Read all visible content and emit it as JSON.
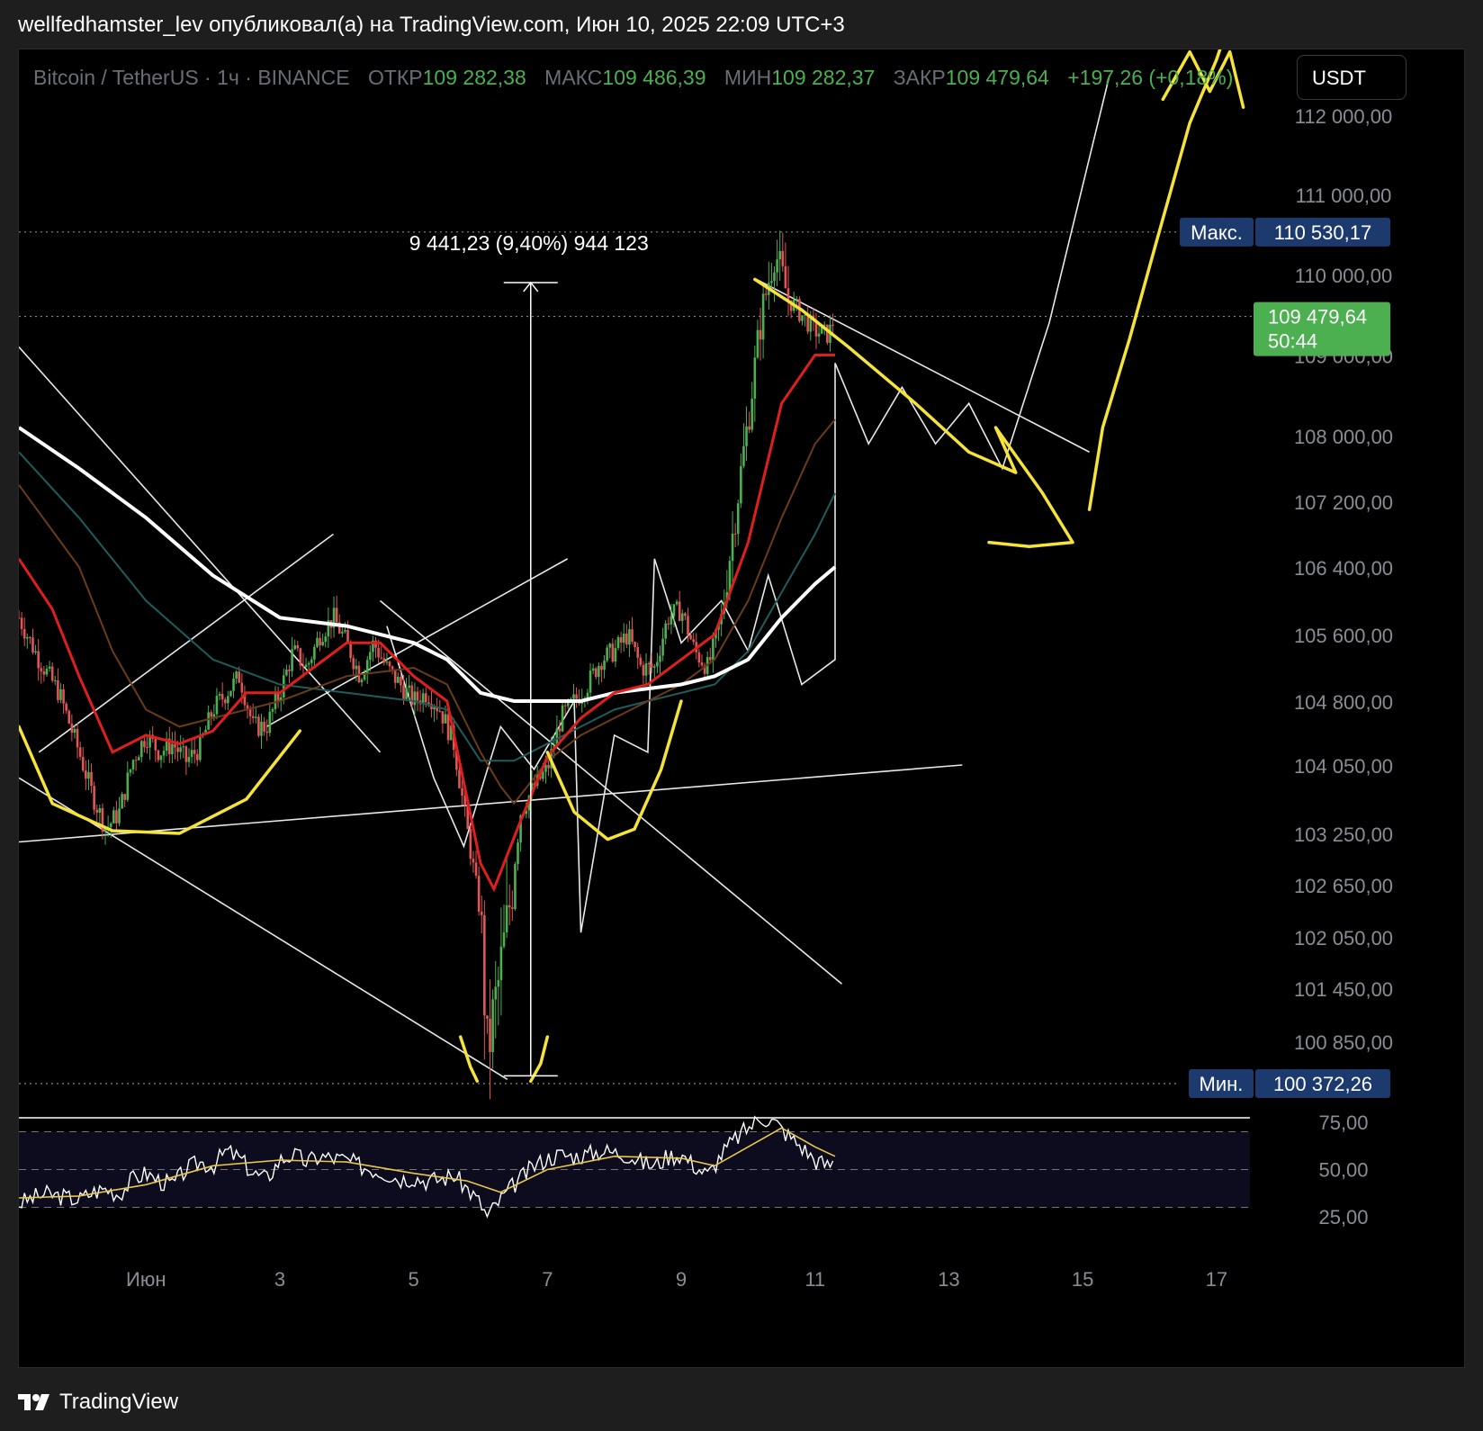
{
  "header": {
    "publish_line": "wellfedhamster_lev опубликовал(а) на TradingView.com, Июн 10, 2025 22:09 UTC+3"
  },
  "legend": {
    "symbol": "Bitcoin / TetherUS · 1ч · BINANCE",
    "open_label": "ОТКР",
    "open_value": "109 282,38",
    "high_label": "МАКС",
    "high_value": "109 486,39",
    "low_label": "МИН",
    "low_value": "109 282,37",
    "close_label": "ЗАКР",
    "close_value": "109 479,64",
    "change": "+197,26 (+0,18%)"
  },
  "currency_button": "USDT",
  "footer": {
    "brand": "TradingView"
  },
  "colors": {
    "background": "#000000",
    "bull": "#4caf50",
    "bear": "#e05555",
    "drawing_yellow": "#f5e33a",
    "drawing_white": "#ffffff",
    "ema_red": "#e01e1e",
    "price_badge": "#4caf50",
    "range_badge": "#1c3a6e"
  },
  "chart_data": {
    "type": "candlestick",
    "symbol": "Bitcoin / TetherUS",
    "timeframe": "1ч",
    "exchange": "BINANCE",
    "y_ticks": [
      "112 000,00",
      "111 000,00",
      "110 000,00",
      "108 000,00",
      "107 200,00",
      "106 400,00",
      "105 600,00",
      "104 800,00",
      "104 050,00",
      "103 250,00",
      "102 650,00",
      "102 050,00",
      "101 450,00",
      "100 850,00"
    ],
    "y_tick_values": [
      112000,
      111000,
      110000,
      108000,
      107200,
      106400,
      105600,
      104800,
      104050,
      103250,
      102650,
      102050,
      101450,
      100850
    ],
    "x_ticks": [
      "Июн",
      "3",
      "5",
      "7",
      "9",
      "11",
      "13",
      "15",
      "17"
    ],
    "x_tick_days": [
      1,
      3,
      5,
      7,
      9,
      11,
      13,
      15,
      17
    ],
    "x_range": [
      -0.9,
      17.5
    ],
    "high_label": "Макс.",
    "high_value": "110 530,17",
    "high_num": 110530.17,
    "low_label": "Мин.",
    "low_value": "100 372,26",
    "low_num": 100372.26,
    "last_price": "109 479,64",
    "last_num": 109479.64,
    "countdown": "50:44",
    "hidden_tick": "109 000,00",
    "measure_label": "9 441,23 (9,40%) 944 123",
    "measure_top": 109900,
    "measure_bottom": 100460,
    "measure_day": 6.75,
    "close_series": [
      [
        -0.9,
        105800
      ],
      [
        -0.6,
        105300
      ],
      [
        -0.3,
        104900
      ],
      [
        0,
        104200
      ],
      [
        0.2,
        103700
      ],
      [
        0.4,
        103300
      ],
      [
        0.6,
        103500
      ],
      [
        0.8,
        104100
      ],
      [
        1.0,
        104400
      ],
      [
        1.2,
        104200
      ],
      [
        1.4,
        104300
      ],
      [
        1.6,
        104100
      ],
      [
        1.8,
        104250
      ],
      [
        2.0,
        104700
      ],
      [
        2.2,
        104900
      ],
      [
        2.4,
        105100
      ],
      [
        2.6,
        104500
      ],
      [
        2.8,
        104500
      ],
      [
        3.0,
        104900
      ],
      [
        3.2,
        105400
      ],
      [
        3.4,
        105200
      ],
      [
        3.6,
        105600
      ],
      [
        3.8,
        105800
      ],
      [
        4.0,
        105500
      ],
      [
        4.2,
        105100
      ],
      [
        4.4,
        105500
      ],
      [
        4.6,
        105200
      ],
      [
        4.8,
        105000
      ],
      [
        5.0,
        104800
      ],
      [
        5.2,
        104900
      ],
      [
        5.4,
        104700
      ],
      [
        5.6,
        104300
      ],
      [
        5.8,
        103300
      ],
      [
        6.0,
        102300
      ],
      [
        6.1,
        100700
      ],
      [
        6.25,
        101400
      ],
      [
        6.4,
        102200
      ],
      [
        6.6,
        103500
      ],
      [
        6.8,
        103800
      ],
      [
        7.0,
        104000
      ],
      [
        7.2,
        104600
      ],
      [
        7.4,
        104800
      ],
      [
        7.6,
        105000
      ],
      [
        7.8,
        105300
      ],
      [
        8.0,
        105400
      ],
      [
        8.2,
        105600
      ],
      [
        8.4,
        105200
      ],
      [
        8.6,
        105200
      ],
      [
        8.8,
        105800
      ],
      [
        9.0,
        105900
      ],
      [
        9.2,
        105400
      ],
      [
        9.4,
        105200
      ],
      [
        9.6,
        105800
      ],
      [
        9.8,
        107000
      ],
      [
        10.0,
        108200
      ],
      [
        10.2,
        109500
      ],
      [
        10.4,
        110300
      ],
      [
        10.6,
        109700
      ],
      [
        10.8,
        109500
      ],
      [
        11.0,
        109300
      ],
      [
        11.2,
        109250
      ],
      [
        11.3,
        109480
      ]
    ],
    "ema_red": [
      [
        -0.9,
        106500
      ],
      [
        -0.4,
        105900
      ],
      [
        0,
        105100
      ],
      [
        0.5,
        104200
      ],
      [
        1.0,
        104400
      ],
      [
        1.5,
        104300
      ],
      [
        2.0,
        104450
      ],
      [
        2.5,
        104900
      ],
      [
        3.0,
        104900
      ],
      [
        3.5,
        105200
      ],
      [
        4.0,
        105500
      ],
      [
        4.5,
        105500
      ],
      [
        5.0,
        105100
      ],
      [
        5.5,
        104800
      ],
      [
        6.0,
        102900
      ],
      [
        6.2,
        102600
      ],
      [
        6.6,
        103400
      ],
      [
        7.0,
        104150
      ],
      [
        7.5,
        104600
      ],
      [
        8.0,
        104900
      ],
      [
        8.5,
        105000
      ],
      [
        9.0,
        105300
      ],
      [
        9.5,
        105600
      ],
      [
        10.0,
        106700
      ],
      [
        10.5,
        108400
      ],
      [
        11.0,
        109000
      ],
      [
        11.3,
        109000
      ]
    ],
    "ema_slow": [
      [
        -0.9,
        108100
      ],
      [
        0,
        107600
      ],
      [
        1,
        107000
      ],
      [
        2,
        106300
      ],
      [
        3,
        105800
      ],
      [
        4,
        105700
      ],
      [
        5,
        105500
      ],
      [
        5.5,
        105300
      ],
      [
        6,
        104900
      ],
      [
        6.5,
        104800
      ],
      [
        7,
        104800
      ],
      [
        7.5,
        104800
      ],
      [
        8,
        104900
      ],
      [
        8.5,
        104950
      ],
      [
        9,
        105000
      ],
      [
        9.5,
        105100
      ],
      [
        10,
        105300
      ],
      [
        10.5,
        105800
      ],
      [
        11,
        106200
      ],
      [
        11.3,
        106400
      ]
    ],
    "ema_teal": [
      [
        -0.9,
        107800
      ],
      [
        0,
        107000
      ],
      [
        1,
        106000
      ],
      [
        2,
        105300
      ],
      [
        3,
        105000
      ],
      [
        4,
        104900
      ],
      [
        5,
        104800
      ],
      [
        5.5,
        104700
      ],
      [
        6,
        104100
      ],
      [
        6.5,
        104100
      ],
      [
        7,
        104300
      ],
      [
        7.5,
        104500
      ],
      [
        8,
        104700
      ],
      [
        8.5,
        104800
      ],
      [
        9,
        104900
      ],
      [
        9.5,
        105000
      ],
      [
        10,
        105400
      ],
      [
        10.5,
        106100
      ],
      [
        11,
        106800
      ],
      [
        11.3,
        107300
      ]
    ],
    "ema_brown": [
      [
        -0.9,
        107400
      ],
      [
        0,
        106400
      ],
      [
        0.5,
        105400
      ],
      [
        1,
        104700
      ],
      [
        1.5,
        104500
      ],
      [
        2,
        104600
      ],
      [
        3,
        104800
      ],
      [
        4,
        105100
      ],
      [
        5,
        105200
      ],
      [
        5.5,
        105000
      ],
      [
        6,
        104200
      ],
      [
        6.3,
        103800
      ],
      [
        6.5,
        103600
      ],
      [
        7,
        104100
      ],
      [
        7.5,
        104400
      ],
      [
        8,
        104600
      ],
      [
        8.5,
        104800
      ],
      [
        9,
        105000
      ],
      [
        9.5,
        105300
      ],
      [
        10,
        106000
      ],
      [
        10.5,
        107000
      ],
      [
        11,
        107900
      ],
      [
        11.3,
        108200
      ]
    ],
    "rsi": {
      "levels": [
        25,
        50,
        75
      ],
      "tick_labels": [
        "75,00",
        "50,00",
        "25,00"
      ],
      "series": [
        [
          -0.9,
          32
        ],
        [
          -0.7,
          35
        ],
        [
          -0.5,
          37
        ],
        [
          -0.3,
          36
        ],
        [
          0,
          34
        ],
        [
          0.2,
          38
        ],
        [
          0.4,
          40
        ],
        [
          0.6,
          37
        ],
        [
          0.8,
          45
        ],
        [
          1.0,
          48
        ],
        [
          1.2,
          44
        ],
        [
          1.4,
          42
        ],
        [
          1.6,
          50
        ],
        [
          1.8,
          54
        ],
        [
          2.0,
          52
        ],
        [
          2.2,
          60
        ],
        [
          2.4,
          56
        ],
        [
          2.6,
          48
        ],
        [
          2.8,
          45
        ],
        [
          3.0,
          55
        ],
        [
          3.2,
          58
        ],
        [
          3.4,
          54
        ],
        [
          3.6,
          57
        ],
        [
          3.8,
          56
        ],
        [
          4.0,
          55
        ],
        [
          4.2,
          52
        ],
        [
          4.4,
          50
        ],
        [
          4.6,
          48
        ],
        [
          4.8,
          45
        ],
        [
          5.0,
          46
        ],
        [
          5.2,
          44
        ],
        [
          5.4,
          45
        ],
        [
          5.6,
          47
        ],
        [
          5.8,
          40
        ],
        [
          6.0,
          32
        ],
        [
          6.1,
          25
        ],
        [
          6.25,
          32
        ],
        [
          6.5,
          42
        ],
        [
          6.8,
          52
        ],
        [
          7.0,
          56
        ],
        [
          7.2,
          58
        ],
        [
          7.4,
          57
        ],
        [
          7.6,
          58
        ],
        [
          7.8,
          60
        ],
        [
          8.0,
          59
        ],
        [
          8.2,
          58
        ],
        [
          8.4,
          54
        ],
        [
          8.6,
          52
        ],
        [
          8.8,
          57
        ],
        [
          9.0,
          58
        ],
        [
          9.2,
          52
        ],
        [
          9.4,
          47
        ],
        [
          9.6,
          58
        ],
        [
          9.8,
          66
        ],
        [
          10.0,
          72
        ],
        [
          10.2,
          78
        ],
        [
          10.4,
          75
        ],
        [
          10.6,
          68
        ],
        [
          10.8,
          62
        ],
        [
          11.0,
          55
        ],
        [
          11.2,
          52
        ],
        [
          11.3,
          55
        ]
      ],
      "ma": [
        [
          -0.9,
          35
        ],
        [
          0,
          36
        ],
        [
          1,
          42
        ],
        [
          2,
          52
        ],
        [
          3,
          55
        ],
        [
          4,
          54
        ],
        [
          5,
          48
        ],
        [
          5.8,
          44
        ],
        [
          6.3,
          38
        ],
        [
          7,
          50
        ],
        [
          8,
          57
        ],
        [
          9,
          56
        ],
        [
          9.5,
          52
        ],
        [
          10,
          62
        ],
        [
          10.5,
          72
        ],
        [
          11,
          62
        ],
        [
          11.3,
          57
        ]
      ]
    },
    "drawings": {
      "white_lines": [
        [
          [
            -0.9,
            109100
          ],
          [
            4.5,
            104200
          ]
        ],
        [
          [
            4.5,
            106000
          ],
          [
            11.4,
            101500
          ]
        ],
        [
          [
            -0.9,
            103900
          ],
          [
            6.4,
            100420
          ]
        ],
        [
          [
            -0.9,
            103150
          ],
          [
            13.2,
            104050
          ]
        ],
        [
          [
            -0.6,
            104200
          ],
          [
            3.8,
            106800
          ]
        ],
        [
          [
            2.8,
            104500
          ],
          [
            7.3,
            106500
          ]
        ],
        [
          [
            10.1,
            109950
          ],
          [
            15.1,
            107800
          ]
        ]
      ],
      "white_paths": [
        [
          [
            4.6,
            105700
          ],
          [
            5.3,
            103900
          ],
          [
            5.75,
            103100
          ],
          [
            6.3,
            104500
          ],
          [
            6.8,
            104000
          ],
          [
            7.4,
            104800
          ],
          [
            7.5,
            102100
          ],
          [
            8.0,
            104400
          ],
          [
            8.5,
            104200
          ],
          [
            8.6,
            106500
          ],
          [
            9.0,
            105500
          ],
          [
            9.6,
            106000
          ],
          [
            10.0,
            105400
          ],
          [
            10.3,
            106300
          ],
          [
            10.8,
            105000
          ],
          [
            11.3,
            105300
          ],
          [
            11.3,
            108900
          ],
          [
            11.8,
            107900
          ],
          [
            12.3,
            108600
          ],
          [
            12.8,
            107900
          ],
          [
            13.3,
            108400
          ],
          [
            13.8,
            107600
          ],
          [
            14.5,
            109400
          ],
          [
            15.4,
            112500
          ]
        ]
      ],
      "yellow_paths": [
        [
          [
            -0.9,
            104500
          ],
          [
            -0.4,
            103600
          ],
          [
            0.5,
            103280
          ],
          [
            1.5,
            103250
          ],
          [
            2.5,
            103650
          ],
          [
            3.3,
            104450
          ]
        ],
        [
          [
            7.0,
            104200
          ],
          [
            7.4,
            103500
          ],
          [
            7.9,
            103180
          ],
          [
            8.3,
            103300
          ],
          [
            8.7,
            104000
          ],
          [
            9.0,
            104800
          ]
        ],
        [
          [
            5.7,
            100900
          ],
          [
            5.85,
            100560
          ],
          [
            5.95,
            100400
          ]
        ],
        [
          [
            6.75,
            100400
          ],
          [
            6.9,
            100600
          ],
          [
            7.0,
            100900
          ]
        ],
        [
          [
            10.1,
            109940
          ],
          [
            10.8,
            109560
          ],
          [
            11.5,
            109100
          ],
          [
            12.5,
            108400
          ],
          [
            13.3,
            107800
          ],
          [
            14.0,
            107550
          ],
          [
            13.7,
            108100
          ],
          [
            14.4,
            107300
          ],
          [
            14.85,
            106700
          ],
          [
            14.2,
            106650
          ],
          [
            13.6,
            106700
          ]
        ],
        [
          [
            15.1,
            107100
          ],
          [
            15.3,
            108100
          ],
          [
            15.7,
            109200
          ],
          [
            16.1,
            110400
          ],
          [
            16.6,
            111900
          ],
          [
            17.0,
            112700
          ],
          [
            17.2,
            113200
          ]
        ],
        [
          [
            16.2,
            112200
          ],
          [
            16.6,
            112800
          ],
          [
            16.9,
            112300
          ],
          [
            17.2,
            112800
          ],
          [
            17.4,
            112100
          ]
        ]
      ]
    }
  }
}
